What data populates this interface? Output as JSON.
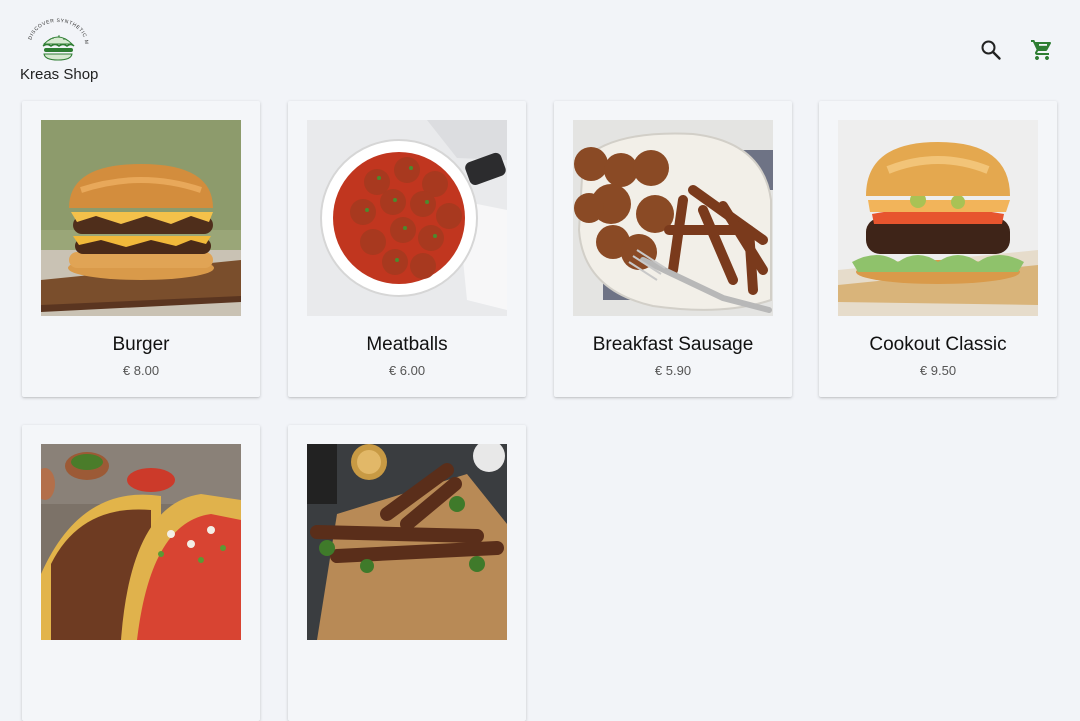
{
  "header": {
    "logo_tagline": "DISCOVER SYNTHETIC MEAT",
    "shop_name": "Kreas Shop",
    "search_icon": "search-icon",
    "cart_icon": "cart-icon",
    "accent_color": "#2e7d32"
  },
  "products": [
    {
      "name": "Burger",
      "price": "€ 8.00",
      "image": "burger"
    },
    {
      "name": "Meatballs",
      "price": "€ 6.00",
      "image": "meatballs"
    },
    {
      "name": "Breakfast Sausage",
      "price": "€ 5.90",
      "image": "sausage"
    },
    {
      "name": "Cookout Classic",
      "price": "€ 9.50",
      "image": "cookout-burger"
    },
    {
      "name": "",
      "price": "",
      "image": "tacos"
    },
    {
      "name": "",
      "price": "",
      "image": "kebab-skewers"
    }
  ]
}
